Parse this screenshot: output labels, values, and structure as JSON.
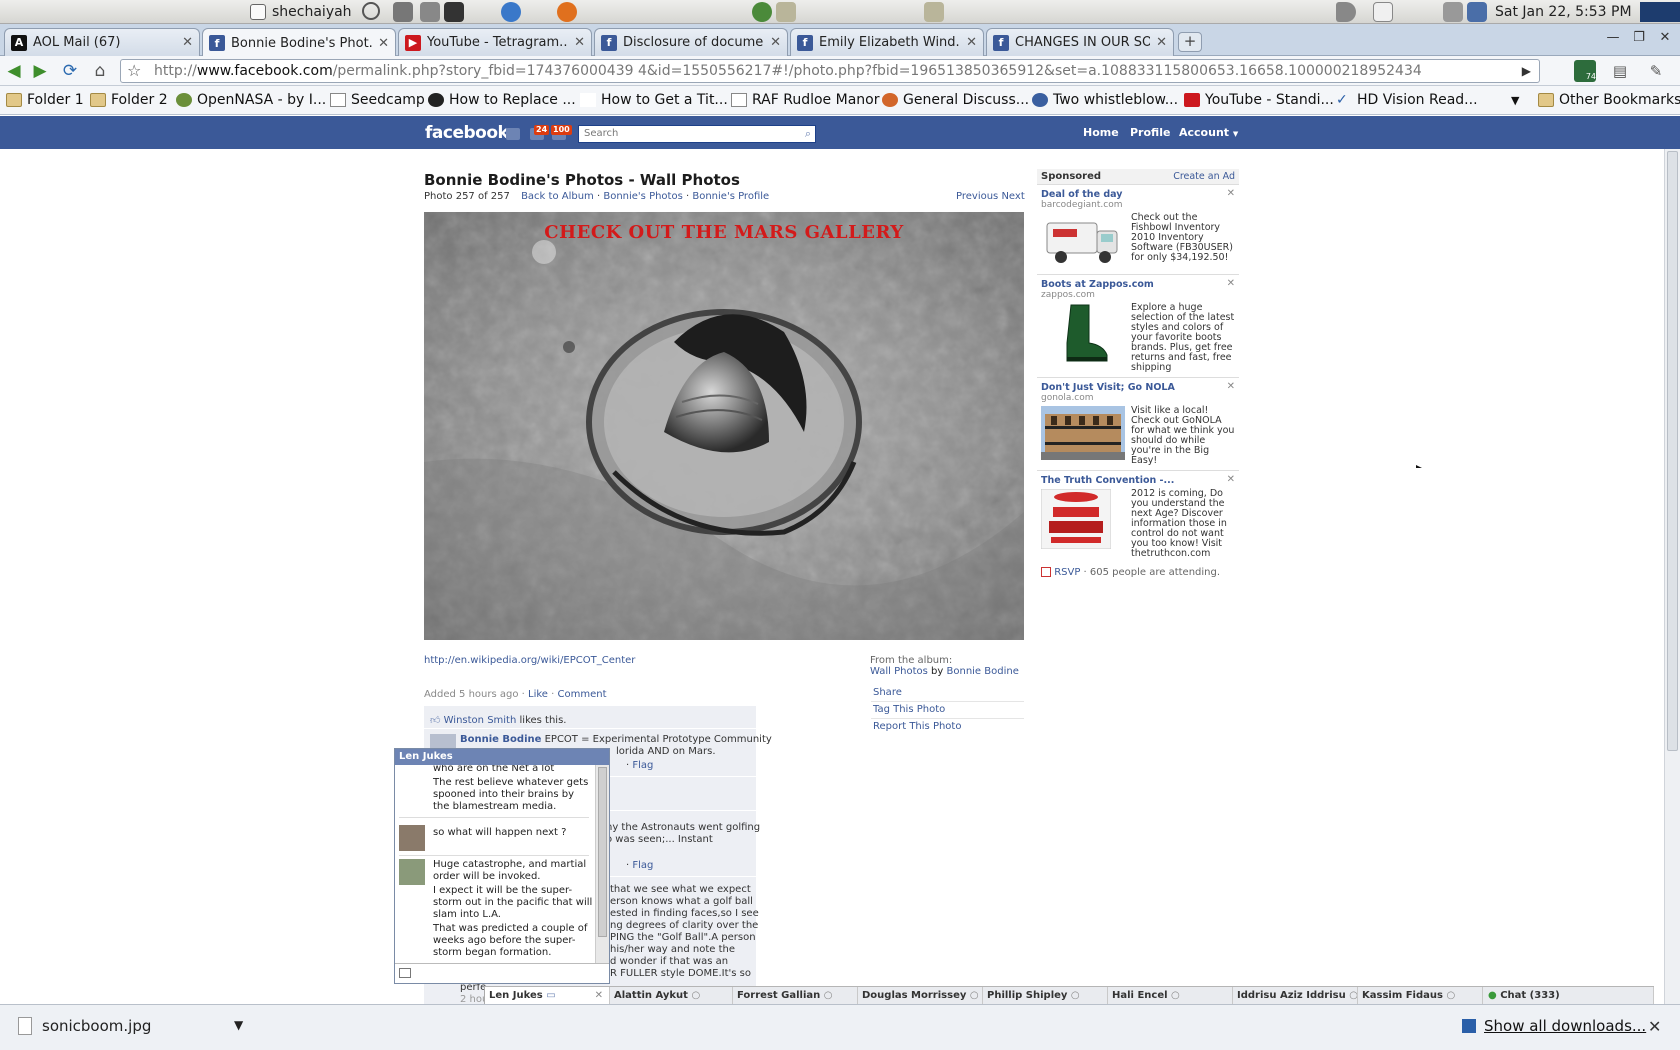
{
  "os_panel": {
    "user": "shechaiyah",
    "clock": "Sat Jan 22,  5:53 PM"
  },
  "tabs": [
    {
      "title": "AOL Mail (67)",
      "icon": "aol-icon",
      "active": false
    },
    {
      "title": "Bonnie Bodine's Phot...",
      "icon": "facebook-icon",
      "active": true
    },
    {
      "title": "YouTube - Tetragram...",
      "icon": "youtube-icon",
      "active": false
    },
    {
      "title": "Disclosure of docume...",
      "icon": "facebook-icon",
      "active": false
    },
    {
      "title": "Emily Elizabeth Wind...",
      "icon": "facebook-icon",
      "active": false
    },
    {
      "title": "CHANGES IN OUR SO...",
      "icon": "facebook-icon",
      "active": false
    }
  ],
  "toolbar": {
    "url_prefix": "http://",
    "url_host": "www.facebook.com",
    "url_path": "/permalink.php?story_fbid=174376000439 4&id=1550556217#!/photo.php?fbid=196513850365912&set=a.108833115800653.16658.100000218952434",
    "extension_badge": "74"
  },
  "bookmarks": [
    {
      "label": "Folder 1",
      "icon": "folder-icon"
    },
    {
      "label": "Folder 2",
      "icon": "folder-icon"
    },
    {
      "label": "OpenNASA - by I...",
      "icon": "site-icon"
    },
    {
      "label": "Seedcamp",
      "icon": "page-icon"
    },
    {
      "label": "How to Replace ...",
      "icon": "site-icon"
    },
    {
      "label": "How to Get a Tit...",
      "icon": "site-icon"
    },
    {
      "label": "RAF Rudloe Manor",
      "icon": "page-icon"
    },
    {
      "label": "General Discuss...",
      "icon": "site-icon"
    },
    {
      "label": "Two whistleblow...",
      "icon": "site-icon"
    },
    {
      "label": "YouTube - Standi...",
      "icon": "youtube-icon"
    },
    {
      "label": "HD Vision Read...",
      "icon": "site-icon"
    }
  ],
  "other_bookmarks": "Other Bookmarks",
  "fb": {
    "logo": "facebook",
    "badge_messages": "24",
    "badge_notifications": "100",
    "search_placeholder": "Search",
    "nav_home": "Home",
    "nav_profile": "Profile",
    "nav_account": "Account"
  },
  "photo_page": {
    "title": "Bonnie Bodine's Photos - Wall Photos",
    "photo_counter": "Photo  257 of 257",
    "back_to_album": "Back to Album",
    "bonnies_photos": "Bonnie's Photos",
    "bonnies_profile": "Bonnie's Profile",
    "sep": " · ",
    "previous": "Previous",
    "next": "Next",
    "caption": "CHECK OUT THE MARS GALLERY",
    "wiki_link": "http://en.wikipedia.org/wiki/EPCOT_Center",
    "added": "Added 5 hours ago",
    "like": "Like",
    "comment": "Comment",
    "from_album": "From the album:",
    "album_name": "Wall Photos",
    "by": "by",
    "album_owner": "Bonnie Bodine",
    "actions": [
      "Share",
      "Tag This Photo",
      "Report This Photo"
    ]
  },
  "comments": {
    "likes_name": "Winston Smith",
    "likes_text": "likes this.",
    "c1_author": "Bonnie Bodine",
    "c1_text": "EPCOT = Experimental Prototype Community",
    "c1_line2": "lorida AND on Mars.",
    "flag": "Flag",
    "c2_line1": "hy the Astronauts went golfing",
    "c2_line2": "o was seen;... Instant",
    "c3_lines": [
      " that we see what we expect",
      "erson knows what a golf ball",
      "ested in finding faces,so I see",
      "ng degrees of clarity over the",
      "PING the \"Golf Ball\".A person",
      "his/her way and note the",
      "d wonder if that was an",
      "R FULLER style DOME.It's so"
    ],
    "c4_line": "perfe",
    "c4_time": "2 hou"
  },
  "sponsored": {
    "heading": "Sponsored",
    "create_ad": "Create an Ad",
    "ads": [
      {
        "title": "Deal of the day",
        "domain": "barcodegiant.com",
        "text": "Check out the Fishbowl Inventory 2010 Inventory Software (FB30USER) for only $34,192.50!",
        "icon": "delivery-truck-icon"
      },
      {
        "title": "Boots at Zappos.com",
        "domain": "zappos.com",
        "text": "Explore a huge selection of the latest styles and colors of your favorite boots brands. Plus, get free returns and fast, free shipping",
        "icon": "green-boot-icon"
      },
      {
        "title": "Don't Just Visit; Go NOLA",
        "domain": "gonola.com",
        "text": "Visit like a local! Check out GoNOLA for what we think you should do while you're in the Big Easy!",
        "icon": "balcony-building-icon"
      },
      {
        "title": "The Truth Convention -...",
        "domain": "",
        "text": "2012 is coming, Do you understand the next Age? Discover information those in control do not want you too know! Visit thetruthcon.com",
        "icon": "truth-convention-poster-icon"
      }
    ],
    "rsvp": "RSVP",
    "rsvp_text": " · 605 people are attending."
  },
  "chat_popup": {
    "name": "Len Jukes",
    "m0": "who are on the Net a lot",
    "m1": "The rest believe whatever gets spooned into their brains by the blamestream media.",
    "m2": "so what will happen next ?",
    "m3": "Huge catastrophe, and martial order will be invoked.",
    "m4": "I expect it will be the super-storm out in the pacific that will slam into L.A.",
    "m5": "That was predicted a couple of weeks ago before the super-storm began formation."
  },
  "chat_bar": {
    "tabs": [
      "Len Jukes",
      "Alattin Aykut",
      "Forrest Gallian",
      "Douglas Morrissey",
      "Phillip Shipley",
      "Hali Encel",
      "Iddrisu Aziz Iddrisu",
      "Kassim Fidaus"
    ],
    "online": "Chat (333)"
  },
  "downloads": {
    "file": "sonicboom.jpg",
    "show_all": "Show all downloads..."
  }
}
